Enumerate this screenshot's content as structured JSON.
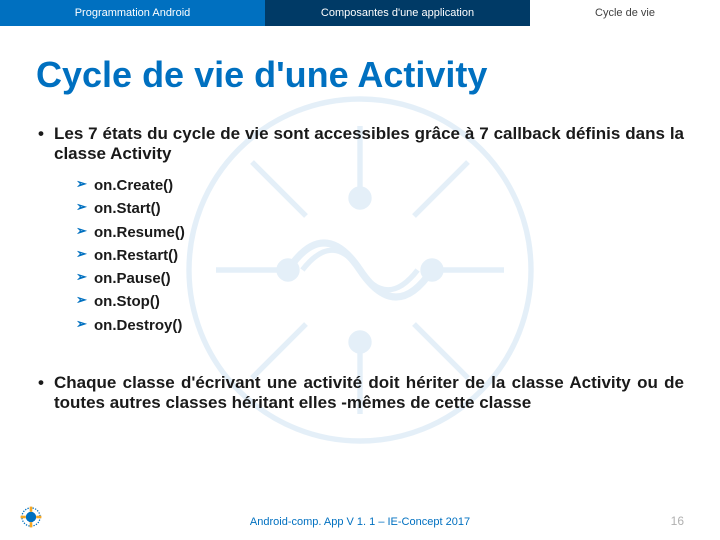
{
  "header": {
    "left": "Programmation Android",
    "mid": "Composantes d'une application",
    "right": "Cycle de vie"
  },
  "title": "Cycle de vie d'une Activity",
  "bullet1": "Les 7 états du cycle de vie sont accessibles grâce à 7 callback définis dans la classe Activity",
  "callbacks": [
    "on.Create()",
    "on.Start()",
    "on.Resume()",
    "on.Restart()",
    "on.Pause()",
    "on.Stop()",
    "on.Destroy()"
  ],
  "bullet2": "Chaque classe d'écrivant une activité doit hériter de la classe Activity ou de toutes autres classes héritant elles -mêmes de cette classe",
  "footer": "Android-comp. App V 1. 1 – IE-Concept 2017",
  "page": "16"
}
